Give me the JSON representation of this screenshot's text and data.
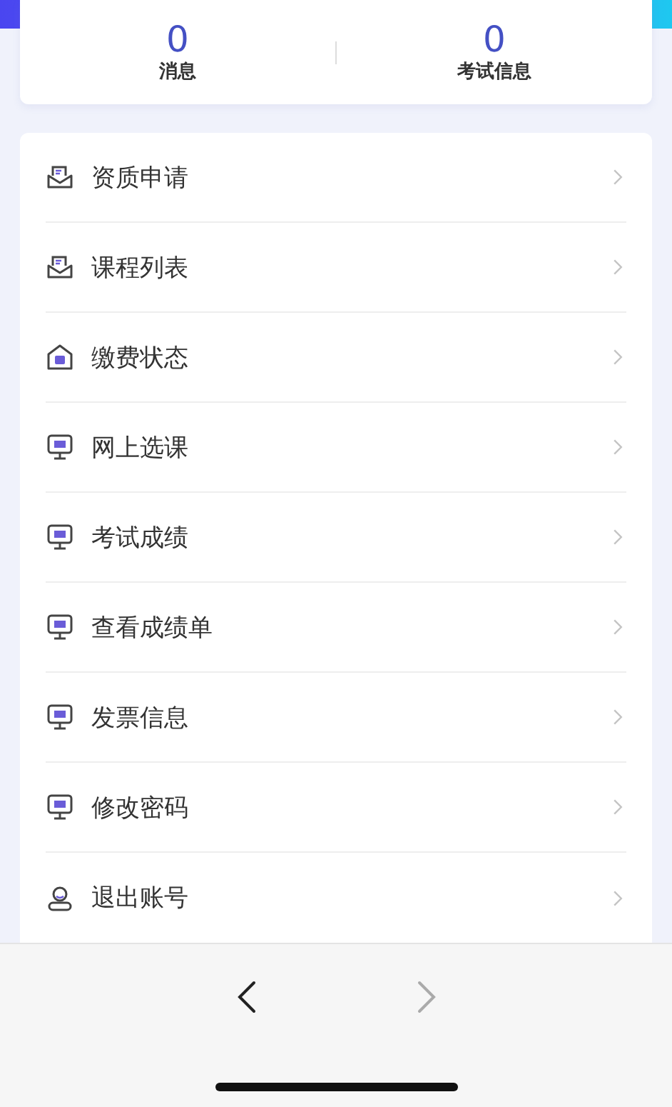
{
  "stats": [
    {
      "value": "0",
      "label": "消息"
    },
    {
      "value": "0",
      "label": "考试信息"
    }
  ],
  "menu": [
    {
      "kind": "inbox",
      "label": "资质申请"
    },
    {
      "kind": "inbox",
      "label": "课程列表"
    },
    {
      "kind": "box",
      "label": "缴费状态"
    },
    {
      "kind": "monitor",
      "label": "网上选课"
    },
    {
      "kind": "monitor",
      "label": "考试成绩"
    },
    {
      "kind": "monitor",
      "label": "查看成绩单"
    },
    {
      "kind": "monitor",
      "label": "发票信息"
    },
    {
      "kind": "monitor",
      "label": "修改密码"
    },
    {
      "kind": "user",
      "label": "退出账号"
    }
  ],
  "browser_nav": {
    "back": {
      "disabled": false
    },
    "forward": {
      "disabled": true
    }
  }
}
